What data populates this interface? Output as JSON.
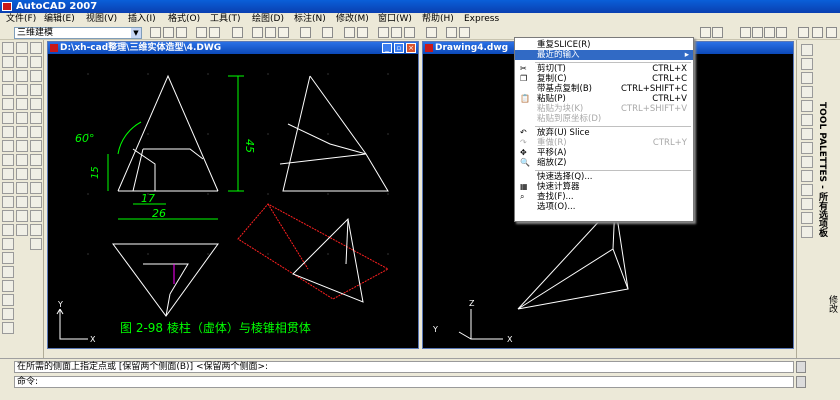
{
  "app": {
    "title": "AutoCAD 2007"
  },
  "menu": [
    "文件(F)",
    "编辑(E)",
    "视图(V)",
    "插入(I)",
    "格式(O)",
    "工具(T)",
    "绘图(D)",
    "标注(N)",
    "修改(M)",
    "窗口(W)",
    "帮助(H)",
    "Express"
  ],
  "toolbar": {
    "workspace": "三维建模"
  },
  "left_window": {
    "title": "D:\\xh-cad整理\\三维实体造型\\4.DWG",
    "dims": {
      "angle": "60°",
      "d15": "15",
      "d17": "17",
      "d26": "26",
      "d45": "45"
    },
    "ucs": {
      "x": "X",
      "y": "Y"
    },
    "caption": "图 2-98  棱柱（虚体）与棱锥相贯体"
  },
  "right_window": {
    "title": "Drawing4.dwg",
    "ucs": {
      "x": "X",
      "y": "Y",
      "z": "Z"
    }
  },
  "context_menu": {
    "items": [
      {
        "label": "重复SLICE(R)",
        "shortcut": "",
        "state": "normal"
      },
      {
        "label": "最近的输入",
        "shortcut": "",
        "state": "highlight",
        "submenu": true
      },
      {
        "label": "剪切(T)",
        "shortcut": "CTRL+X",
        "state": "normal",
        "icon": "scissors-icon"
      },
      {
        "label": "复制(C)",
        "shortcut": "CTRL+C",
        "state": "normal",
        "icon": "copy-icon"
      },
      {
        "label": "带基点复制(B)",
        "shortcut": "CTRL+SHIFT+C",
        "state": "normal"
      },
      {
        "label": "粘贴(P)",
        "shortcut": "CTRL+V",
        "state": "normal",
        "icon": "paste-icon"
      },
      {
        "label": "粘贴为块(K)",
        "shortcut": "CTRL+SHIFT+V",
        "state": "disabled"
      },
      {
        "label": "粘贴到原坐标(D)",
        "shortcut": "",
        "state": "disabled"
      },
      {
        "label": "放弃(U) Slice",
        "shortcut": "",
        "state": "normal",
        "icon": "undo-icon"
      },
      {
        "label": "重做(R)",
        "shortcut": "CTRL+Y",
        "state": "disabled",
        "icon": "redo-icon"
      },
      {
        "label": "平移(A)",
        "shortcut": "",
        "state": "normal",
        "icon": "pan-icon"
      },
      {
        "label": "缩放(Z)",
        "shortcut": "",
        "state": "normal",
        "icon": "zoom-icon"
      },
      {
        "label": "快速选择(Q)...",
        "shortcut": "",
        "state": "normal"
      },
      {
        "label": "快速计算器",
        "shortcut": "",
        "state": "normal",
        "icon": "calculator-icon"
      },
      {
        "label": "查找(F)...",
        "shortcut": "",
        "state": "normal",
        "icon": "find-icon"
      },
      {
        "label": "选项(O)...",
        "shortcut": "",
        "state": "normal"
      }
    ]
  },
  "palette": {
    "title": "TOOL PALETTES - 所有选项板",
    "side_label": "修改"
  },
  "command": {
    "history": "在所需的侧面上指定点或 [保留两个侧面(B)] <保留两个侧面>:",
    "prompt": "命令:"
  },
  "colors": {
    "title_bar": "#0a4fcf",
    "canvas": "#000000",
    "highlight": "#316ac5",
    "dim_green": "#00ff00",
    "red_prism": "#ff2020"
  }
}
